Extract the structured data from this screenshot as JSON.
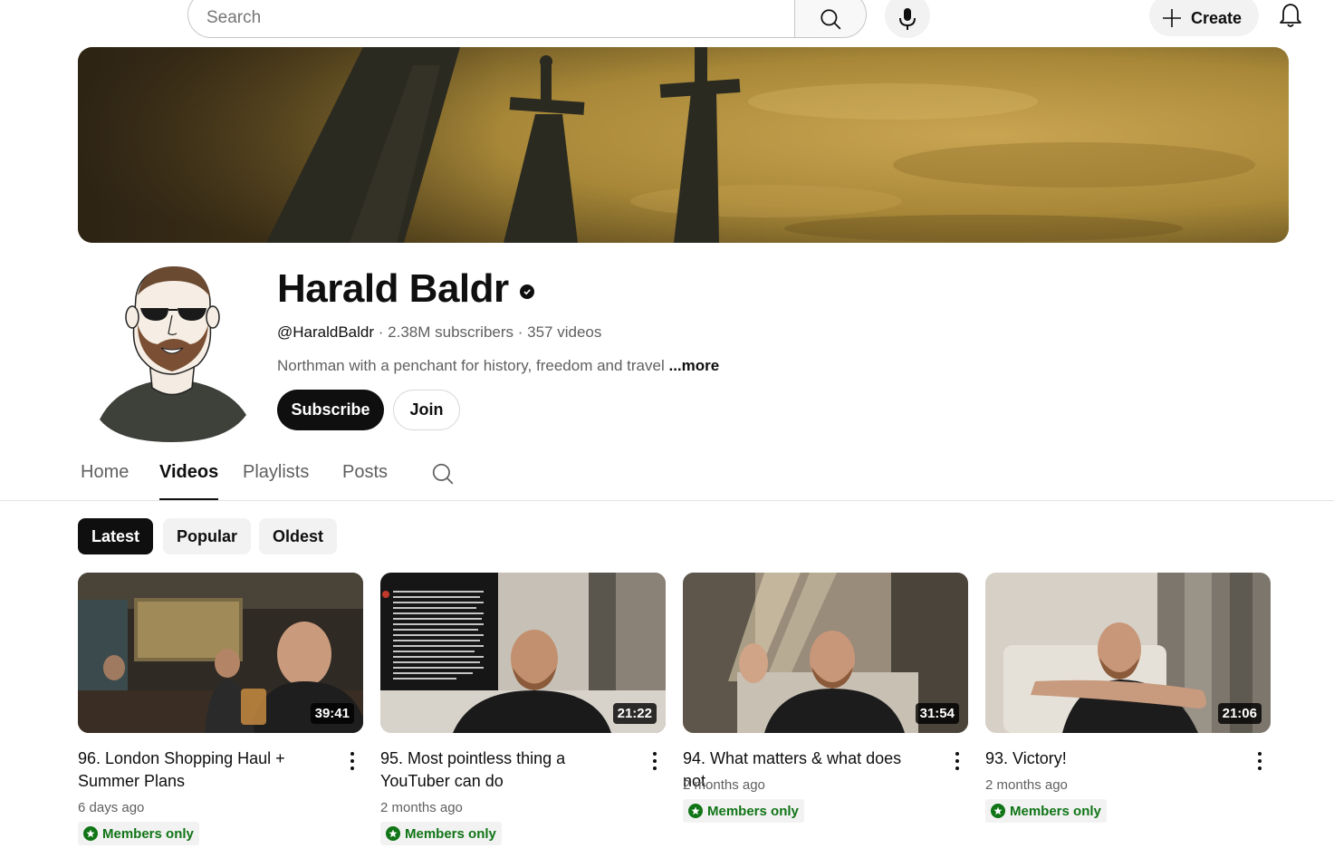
{
  "header": {
    "search_placeholder": "Search",
    "create_label": "Create",
    "icons": [
      "search-icon",
      "mic-icon",
      "plus-icon",
      "bell-icon"
    ]
  },
  "channel": {
    "name": "Harald Baldr",
    "handle": "@HaraldBaldr",
    "subscribers": "2.38M subscribers",
    "video_count": "357 videos",
    "separator": " · ",
    "description": "Northman with a penchant for history, freedom and travel",
    "more_label": "...more",
    "subscribe_label": "Subscribe",
    "join_label": "Join"
  },
  "tabs": [
    {
      "label": "Home"
    },
    {
      "label": "Videos",
      "active": true
    },
    {
      "label": "Playlists"
    },
    {
      "label": "Posts"
    }
  ],
  "chips": [
    {
      "label": "Latest",
      "active": true
    },
    {
      "label": "Popular"
    },
    {
      "label": "Oldest"
    }
  ],
  "videos": [
    {
      "title": "96. London Shopping Haul + Summer Plans",
      "duration": "39:41",
      "age": "6 days ago",
      "badge": "Members only"
    },
    {
      "title": "95. Most pointless thing a YouTuber can do",
      "duration": "21:22",
      "age": "2 months ago",
      "badge": "Members only"
    },
    {
      "title": "94. What matters & what does not",
      "duration": "31:54",
      "age": "2 months ago",
      "badge": "Members only"
    },
    {
      "title": "93. Victory!",
      "duration": "21:06",
      "age": "2 months ago",
      "badge": "Members only"
    }
  ],
  "colors": {
    "accent": "#0f0f0f",
    "members_green": "#107516",
    "banner_sky": "#b39247"
  }
}
